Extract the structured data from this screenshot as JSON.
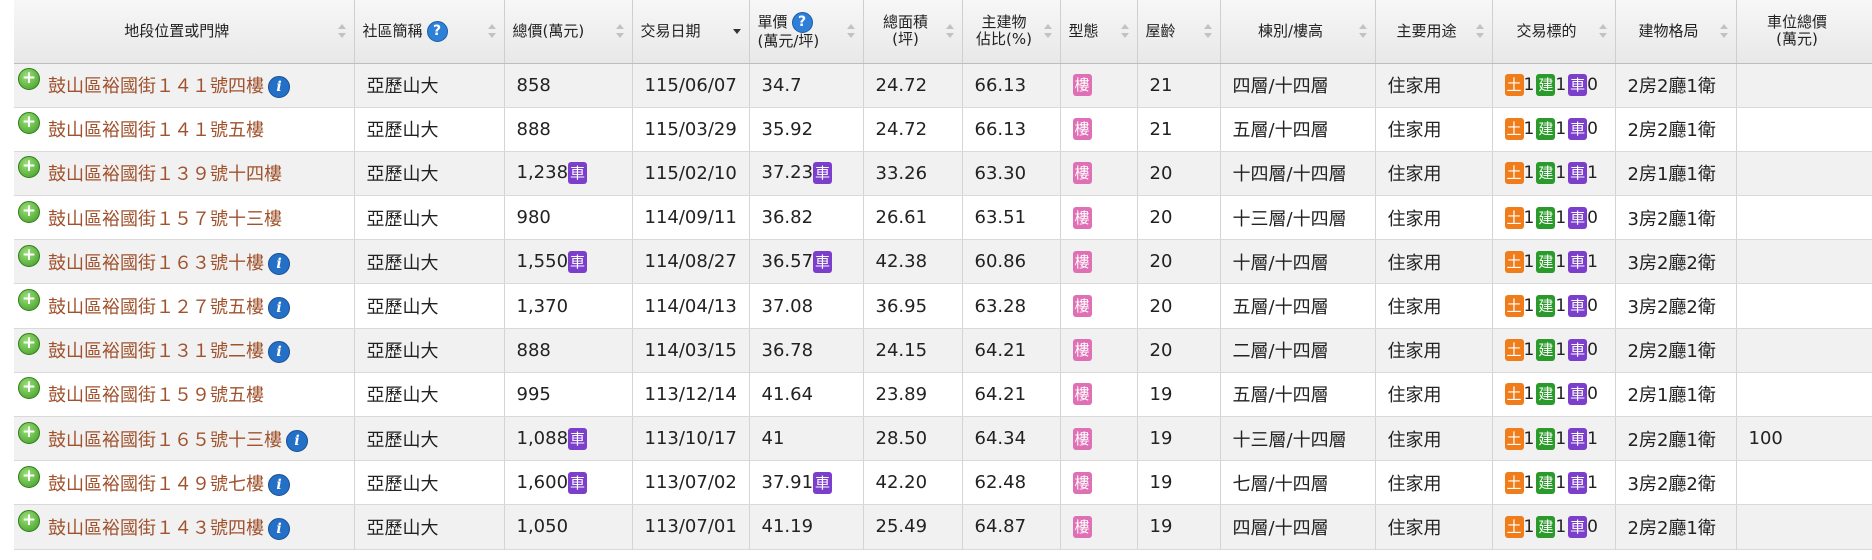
{
  "headers": {
    "address": "地段位置或門牌",
    "community": "社區簡稱",
    "total_price": "總價(萬元)",
    "date": "交易日期",
    "unit_price_1": "單價",
    "unit_price_2": "(萬元/坪)",
    "area_1": "總面積",
    "area_2": "(坪)",
    "main_ratio_1": "主建物",
    "main_ratio_2": "佔比(%)",
    "type": "型態",
    "age": "屋齡",
    "floor": "棟別/樓高",
    "usage": "主要用途",
    "target": "交易標的",
    "layout": "建物格局",
    "parking_1": "車位總價",
    "parking_2": "(萬元)"
  },
  "icons": {
    "help": "?",
    "expand": "+",
    "info": "i"
  },
  "badges": {
    "car": "車",
    "building": "樓",
    "land": "土",
    "structure": "建"
  },
  "colors": {
    "address_text": "#a0522d",
    "car_badge": "#7b3fcc",
    "building_badge": "#e070b5",
    "land_badge": "#f07c1a",
    "structure_badge": "#2a9a2a"
  },
  "rows": [
    {
      "address": "鼓山區裕國街１４１號四樓",
      "info": true,
      "community": "亞歷山大",
      "total_price": "858",
      "price_car": false,
      "date": "115/06/07",
      "unit_price": "34.7",
      "unit_car": false,
      "area": "24.72",
      "ratio": "66.13",
      "age": "21",
      "floor": "四層/十四層",
      "usage": "住家用",
      "land": "1",
      "bldg": "1",
      "car": "0",
      "layout": "2房2廳1衛",
      "parking": ""
    },
    {
      "address": "鼓山區裕國街１４１號五樓",
      "info": false,
      "community": "亞歷山大",
      "total_price": "888",
      "price_car": false,
      "date": "115/03/29",
      "unit_price": "35.92",
      "unit_car": false,
      "area": "24.72",
      "ratio": "66.13",
      "age": "21",
      "floor": "五層/十四層",
      "usage": "住家用",
      "land": "1",
      "bldg": "1",
      "car": "0",
      "layout": "2房2廳1衛",
      "parking": ""
    },
    {
      "address": "鼓山區裕國街１３９號十四樓",
      "info": false,
      "community": "亞歷山大",
      "total_price": "1,238",
      "price_car": true,
      "date": "115/02/10",
      "unit_price": "37.23",
      "unit_car": true,
      "area": "33.26",
      "ratio": "63.30",
      "age": "20",
      "floor": "十四層/十四層",
      "usage": "住家用",
      "land": "1",
      "bldg": "1",
      "car": "1",
      "layout": "2房1廳1衛",
      "parking": ""
    },
    {
      "address": "鼓山區裕國街１５７號十三樓",
      "info": false,
      "community": "亞歷山大",
      "total_price": "980",
      "price_car": false,
      "date": "114/09/11",
      "unit_price": "36.82",
      "unit_car": false,
      "area": "26.61",
      "ratio": "63.51",
      "age": "20",
      "floor": "十三層/十四層",
      "usage": "住家用",
      "land": "1",
      "bldg": "1",
      "car": "0",
      "layout": "3房2廳1衛",
      "parking": ""
    },
    {
      "address": "鼓山區裕國街１６３號十樓",
      "info": true,
      "community": "亞歷山大",
      "total_price": "1,550",
      "price_car": true,
      "date": "114/08/27",
      "unit_price": "36.57",
      "unit_car": true,
      "area": "42.38",
      "ratio": "60.86",
      "age": "20",
      "floor": "十層/十四層",
      "usage": "住家用",
      "land": "1",
      "bldg": "1",
      "car": "1",
      "layout": "3房2廳2衛",
      "parking": ""
    },
    {
      "address": "鼓山區裕國街１２７號五樓",
      "info": true,
      "community": "亞歷山大",
      "total_price": "1,370",
      "price_car": false,
      "date": "114/04/13",
      "unit_price": "37.08",
      "unit_car": false,
      "area": "36.95",
      "ratio": "63.28",
      "age": "20",
      "floor": "五層/十四層",
      "usage": "住家用",
      "land": "1",
      "bldg": "1",
      "car": "0",
      "layout": "3房2廳2衛",
      "parking": ""
    },
    {
      "address": "鼓山區裕國街１３１號二樓",
      "info": true,
      "community": "亞歷山大",
      "total_price": "888",
      "price_car": false,
      "date": "114/03/15",
      "unit_price": "36.78",
      "unit_car": false,
      "area": "24.15",
      "ratio": "64.21",
      "age": "20",
      "floor": "二層/十四層",
      "usage": "住家用",
      "land": "1",
      "bldg": "1",
      "car": "0",
      "layout": "2房2廳1衛",
      "parking": ""
    },
    {
      "address": "鼓山區裕國街１５９號五樓",
      "info": false,
      "community": "亞歷山大",
      "total_price": "995",
      "price_car": false,
      "date": "113/12/14",
      "unit_price": "41.64",
      "unit_car": false,
      "area": "23.89",
      "ratio": "64.21",
      "age": "19",
      "floor": "五層/十四層",
      "usage": "住家用",
      "land": "1",
      "bldg": "1",
      "car": "0",
      "layout": "2房1廳1衛",
      "parking": ""
    },
    {
      "address": "鼓山區裕國街１６５號十三樓",
      "info": true,
      "community": "亞歷山大",
      "total_price": "1,088",
      "price_car": true,
      "date": "113/10/17",
      "unit_price": "41",
      "unit_car": false,
      "area": "28.50",
      "ratio": "64.34",
      "age": "19",
      "floor": "十三層/十四層",
      "usage": "住家用",
      "land": "1",
      "bldg": "1",
      "car": "1",
      "layout": "2房2廳1衛",
      "parking": "100"
    },
    {
      "address": "鼓山區裕國街１４９號七樓",
      "info": true,
      "community": "亞歷山大",
      "total_price": "1,600",
      "price_car": true,
      "date": "113/07/02",
      "unit_price": "37.91",
      "unit_car": true,
      "area": "42.20",
      "ratio": "62.48",
      "age": "19",
      "floor": "七層/十四層",
      "usage": "住家用",
      "land": "1",
      "bldg": "1",
      "car": "1",
      "layout": "3房2廳2衛",
      "parking": ""
    },
    {
      "address": "鼓山區裕國街１４３號四樓",
      "info": true,
      "community": "亞歷山大",
      "total_price": "1,050",
      "price_car": false,
      "date": "113/07/01",
      "unit_price": "41.19",
      "unit_car": false,
      "area": "25.49",
      "ratio": "64.87",
      "age": "19",
      "floor": "四層/十四層",
      "usage": "住家用",
      "land": "1",
      "bldg": "1",
      "car": "0",
      "layout": "2房2廳1衛",
      "parking": ""
    }
  ]
}
